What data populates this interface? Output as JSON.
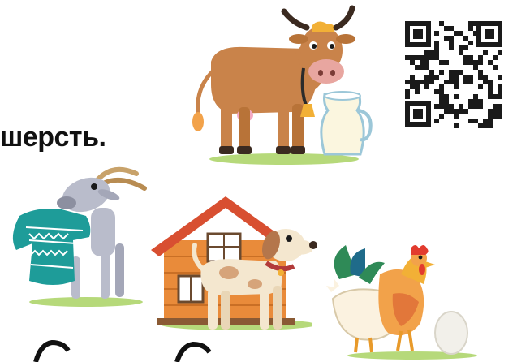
{
  "text": {
    "caption_fragment": "шерсть."
  },
  "illustrations": {
    "cow": "cow-with-milk-jug",
    "goat": "goat-in-sweater",
    "house": "dog-house",
    "dog": "dog",
    "rooster": "rooster-and-hen-with-egg",
    "qr": "qr-code"
  },
  "colors": {
    "cow_body": "#c9834a",
    "cow_dark": "#3b2a20",
    "milk": "#fbf6df",
    "sweater": "#1e9c99",
    "goat": "#b9bccb",
    "house_wall": "#e98b3a",
    "roof": "#d84f31",
    "dog": "#f4e7cf",
    "dog_ear": "#b4764b",
    "grass": "#b6d97a",
    "rooster_red": "#e23b2e",
    "rooster_green": "#2f8a57"
  }
}
